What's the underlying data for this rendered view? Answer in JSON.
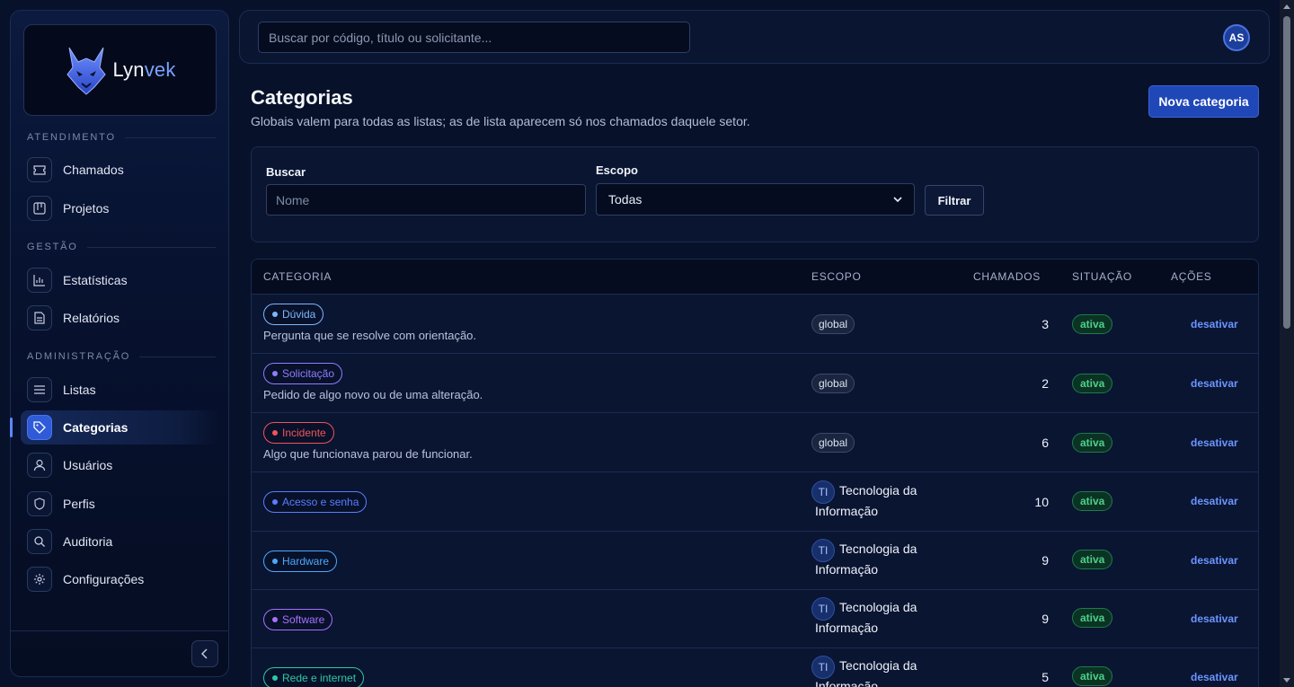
{
  "brand": {
    "name_part1": "Lyn",
    "name_part2": "vek"
  },
  "sidebar": {
    "sections": [
      {
        "label": "ATENDIMENTO"
      },
      {
        "label": "GESTÃO"
      },
      {
        "label": "ADMINISTRAÇÃO"
      }
    ],
    "items": [
      {
        "label": "Chamados",
        "icon": "ticket-icon"
      },
      {
        "label": "Projetos",
        "icon": "kanban-icon"
      },
      {
        "label": "Estatísticas",
        "icon": "bar-chart-icon"
      },
      {
        "label": "Relatórios",
        "icon": "document-icon"
      },
      {
        "label": "Listas",
        "icon": "list-icon"
      },
      {
        "label": "Categorias",
        "icon": "tag-icon",
        "active": true
      },
      {
        "label": "Usuários",
        "icon": "user-icon"
      },
      {
        "label": "Perfis",
        "icon": "shield-icon"
      },
      {
        "label": "Auditoria",
        "icon": "search-icon"
      },
      {
        "label": "Configurações",
        "icon": "gear-icon"
      }
    ]
  },
  "topbar": {
    "search_placeholder": "Buscar por código, título ou solicitante...",
    "avatar_initials": "AS"
  },
  "page": {
    "title": "Categorias",
    "subtitle": "Globais valem para todas as listas; as de lista aparecem só nos chamados daquele setor.",
    "new_button": "Nova categoria"
  },
  "filters": {
    "search_label": "Buscar",
    "search_placeholder": "Nome",
    "scope_label": "Escopo",
    "scope_value": "Todas",
    "filter_button": "Filtrar"
  },
  "table": {
    "headers": [
      "CATEGORIA",
      "ESCOPO",
      "CHAMADOS",
      "SITUAÇÃO",
      "AÇÕES"
    ],
    "rows": [
      {
        "name": "Dúvida",
        "color": "#7fb6ff",
        "desc": "Pergunta que se resolve com orientação.",
        "scope": "global",
        "count": "3",
        "status": "ativa",
        "action": "desativar"
      },
      {
        "name": "Solicitação",
        "color": "#8f7cff",
        "desc": "Pedido de algo novo ou de uma alteração.",
        "scope": "global",
        "count": "2",
        "status": "ativa",
        "action": "desativar"
      },
      {
        "name": "Incidente",
        "color": "#f0545a",
        "desc": "Algo que funcionava parou de funcionar.",
        "scope": "global",
        "count": "6",
        "status": "ativa",
        "action": "desativar"
      },
      {
        "name": "Acesso e senha",
        "color": "#5a7dff",
        "desc": "",
        "scope_badge": "TI",
        "scope_line1": "Tecnologia da",
        "scope_line2": "Informação",
        "count": "10",
        "status": "ativa",
        "action": "desativar"
      },
      {
        "name": "Hardware",
        "color": "#4aa8ff",
        "desc": "",
        "scope_badge": "TI",
        "scope_line1": "Tecnologia da",
        "scope_line2": "Informação",
        "count": "9",
        "status": "ativa",
        "action": "desativar"
      },
      {
        "name": "Software",
        "color": "#a770ff",
        "desc": "",
        "scope_badge": "TI",
        "scope_line1": "Tecnologia da",
        "scope_line2": "Informação",
        "count": "9",
        "status": "ativa",
        "action": "desativar"
      },
      {
        "name": "Rede e internet",
        "color": "#2ec9a2",
        "desc": "",
        "scope_badge": "TI",
        "scope_line1": "Tecnologia da",
        "scope_line2": "Informação",
        "count": "5",
        "status": "ativa",
        "action": "desativar"
      }
    ]
  }
}
